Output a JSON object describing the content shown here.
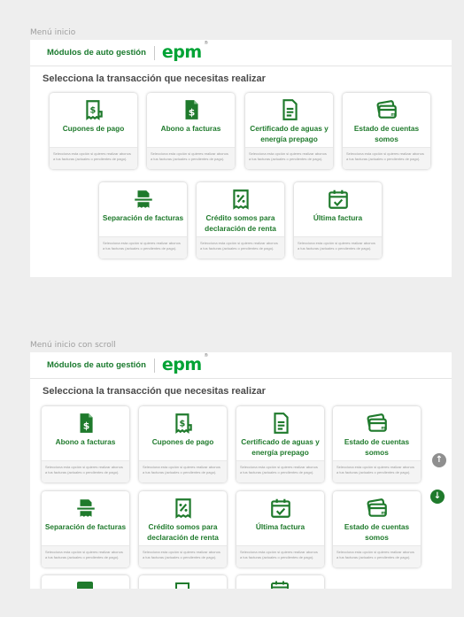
{
  "colors": {
    "primary": "#1f7a2c",
    "brand": "#00a335",
    "muted_text": "#9a9a9a"
  },
  "header": {
    "title": "Módulos de auto gestión",
    "logo_text": "epm",
    "logo_mark": "®"
  },
  "subtitle": "Selecciona la transacción que necesitas realizar",
  "card_description": "Selecciona esta opción si quieres realizar abonos a tus facturas (actuales o pendientes de pago).",
  "frames": [
    {
      "label": "Menú inicio",
      "cards": [
        {
          "title": "Cupones de pago",
          "icon": "receipt-dollar-icon"
        },
        {
          "title": "Abono a facturas",
          "icon": "document-dollar-icon"
        },
        {
          "title": "Certificado de aguas y energía prepago",
          "icon": "certificate-document-icon"
        },
        {
          "title": "Estado de cuentas somos",
          "icon": "somos-cards-icon"
        },
        {
          "title": "Separación de facturas",
          "icon": "split-invoice-icon"
        },
        {
          "title": "Crédito somos para declaración de renta",
          "icon": "percent-receipt-icon"
        },
        {
          "title": "Última factura",
          "icon": "calendar-check-icon"
        }
      ]
    },
    {
      "label": "Menú inicio con scroll",
      "cards": [
        {
          "title": "Abono a facturas",
          "icon": "document-dollar-icon"
        },
        {
          "title": "Cupones de pago",
          "icon": "receipt-dollar-icon"
        },
        {
          "title": "Certificado de aguas y energía prepago",
          "icon": "certificate-document-icon"
        },
        {
          "title": "Estado de cuentas somos",
          "icon": "somos-cards-icon"
        },
        {
          "title": "Separación de facturas",
          "icon": "split-invoice-icon"
        },
        {
          "title": "Crédito somos para declaración de renta",
          "icon": "percent-receipt-icon"
        },
        {
          "title": "Última factura",
          "icon": "calendar-check-icon"
        },
        {
          "title": "Estado de cuentas somos",
          "icon": "somos-cards-icon"
        }
      ],
      "scroll_up_icon": "↑",
      "scroll_down_icon": "↓"
    }
  ]
}
